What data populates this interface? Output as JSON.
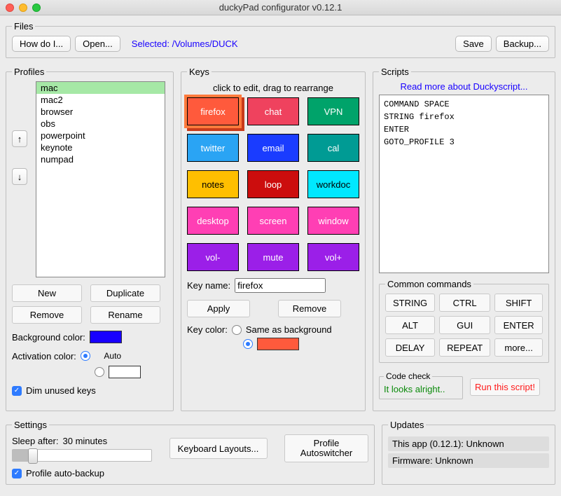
{
  "title": "duckyPad configurator v0.12.1",
  "files": {
    "legend": "Files",
    "howdoi": "How do I...",
    "open": "Open...",
    "selected_label": "Selected:",
    "selected_path": "/Volumes/DUCK",
    "save": "Save",
    "backup": "Backup..."
  },
  "profiles": {
    "legend": "Profiles",
    "items": [
      "mac",
      "mac2",
      "browser",
      "obs",
      "powerpoint",
      "keynote",
      "numpad"
    ],
    "selected_index": 0,
    "arrow_up": "↑",
    "arrow_down": "↓",
    "new": "New",
    "duplicate": "Duplicate",
    "remove": "Remove",
    "rename": "Rename",
    "bgcolor_label": "Background color:",
    "bgcolor": "#1800ff",
    "actcolor_label": "Activation color:",
    "auto": "Auto",
    "dim_label": "Dim unused keys"
  },
  "keys": {
    "legend": "Keys",
    "hint": "click to edit, drag to rearrange",
    "cells": [
      {
        "label": "firefox",
        "bg": "#ff5a3c",
        "selected": true
      },
      {
        "label": "chat",
        "bg": "#ef425e"
      },
      {
        "label": "VPN",
        "bg": "#00a36a"
      },
      {
        "label": "twitter",
        "bg": "#2aa4f4"
      },
      {
        "label": "email",
        "bg": "#1a3cff"
      },
      {
        "label": "cal",
        "bg": "#009b94"
      },
      {
        "label": "notes",
        "bg": "#ffbf00",
        "fg": "#000"
      },
      {
        "label": "loop",
        "bg": "#cc0d0d"
      },
      {
        "label": "workdoc",
        "bg": "#00e8ff",
        "fg": "#000"
      },
      {
        "label": "desktop",
        "bg": "#ff3fb4"
      },
      {
        "label": "screen",
        "bg": "#ff3fb4"
      },
      {
        "label": "window",
        "bg": "#ff3fb4"
      },
      {
        "label": "vol-",
        "bg": "#9b1fe8"
      },
      {
        "label": "mute",
        "bg": "#9b1fe8"
      },
      {
        "label": "vol+",
        "bg": "#9b1fe8"
      }
    ],
    "keyname_label": "Key name:",
    "keyname_value": "firefox",
    "apply": "Apply",
    "remove": "Remove",
    "keycolor_label": "Key color:",
    "same_as_bg": "Same as background",
    "keycolor": "#ff5a3c"
  },
  "scripts": {
    "legend": "Scripts",
    "readmore": "Read more about Duckyscript...",
    "text": "COMMAND SPACE\nSTRING firefox\nENTER\nGOTO_PROFILE 3",
    "common_legend": "Common commands",
    "common": [
      "STRING",
      "CTRL",
      "SHIFT",
      "ALT",
      "GUI",
      "ENTER",
      "DELAY",
      "REPEAT",
      "more..."
    ],
    "codecheck_legend": "Code check",
    "codecheck_msg": "It looks alright..",
    "run": "Run this script!"
  },
  "settings": {
    "legend": "Settings",
    "sleep_label": "Sleep after:",
    "sleep_value": "30 minutes",
    "keyboard_layouts": "Keyboard Layouts...",
    "profile_autoswitcher": "Profile Autoswitcher",
    "autobackup": "Profile auto-backup"
  },
  "updates": {
    "legend": "Updates",
    "app": "This app (0.12.1): Unknown",
    "firmware": "Firmware: Unknown"
  }
}
